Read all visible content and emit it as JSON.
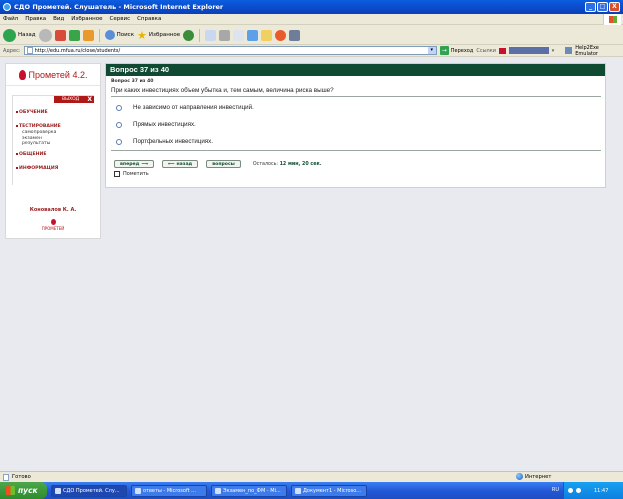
{
  "window": {
    "title": "СДО Прометей. Слушатель - Microsoft Internet Explorer",
    "min_symbol": "_",
    "max_symbol": "□",
    "close_symbol": "X"
  },
  "menubar": [
    "Файл",
    "Правка",
    "Вид",
    "Избранное",
    "Сервис",
    "Справка"
  ],
  "toolbar": {
    "back": "Назад",
    "search": "Поиск",
    "favorites": "Избранное"
  },
  "addressbar": {
    "label": "Адрес:",
    "url": "http://edu.mfua.ru/close/students/",
    "go": "Переход",
    "links": "Ссылки",
    "ext": "Help2Exe Emulator"
  },
  "sidebar": {
    "logo_text": "Прометей 4.2.",
    "exit_label": "ВЫХОД",
    "exit_x": "X",
    "items": [
      {
        "label": "ОБУЧЕНИЕ"
      },
      {
        "label": "ТЕСТИРОВАНИЕ",
        "sub": [
          "самопроверка",
          "экзамен",
          "результаты"
        ]
      },
      {
        "label": "ОБЩЕНИЕ"
      },
      {
        "label": "ИНФОРМАЦИЯ"
      }
    ],
    "user": "Коновалов К. А.",
    "small_logo": "ПРОМЕТЕЙ"
  },
  "question": {
    "header": "Вопрос 37 из 40",
    "sub": "Вопрос 37 из 40",
    "text": "При каких инвестициях объем убытка и, тем самым, величина риска выше?",
    "answers": [
      "Не зависимо от направления инвестиций.",
      "Прямых инвестициях.",
      "Портфельных инвестициях."
    ],
    "buttons": {
      "next": "вперед",
      "back": "назад",
      "questions": "вопросы"
    },
    "remaining_label": "Осталось:",
    "remaining_time": "12 мин, 20 сек.",
    "mark_label": "Пометить"
  },
  "status": {
    "left": "Готово",
    "zone": "Интернет"
  },
  "taskbar": {
    "start": "пуск",
    "tasks": [
      "СДО Прометей. Слу...",
      "ответы - Microsoft ...",
      "Экзамен_по_ФМ - Mi...",
      "Документ1 - Microso..."
    ],
    "lang": "RU",
    "time": "11:47"
  }
}
